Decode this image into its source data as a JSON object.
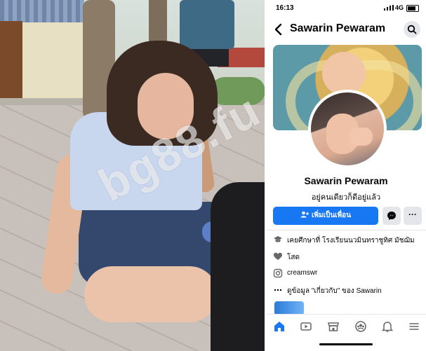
{
  "watermark": "bg88.fu",
  "status_bar": {
    "time": "16:13",
    "network": "4G"
  },
  "header": {
    "title": "Sawarin Pewaram"
  },
  "profile": {
    "name": "Sawarin Pewaram",
    "bio": "อยู่คนเดียวก็ดีอยู่แล้ว",
    "add_friend_label": "เพิ่มเป็นเพื่อน",
    "more_label": "···"
  },
  "details": {
    "education": "เคยศึกษาที่ โรงเรียนนวมินทราชูทิศ มัชฌิม",
    "relationship": "โสด",
    "instagram": "creamswr",
    "see_about": "ดูข้อมูล \"เกี่ยวกับ\" ของ Sawarin"
  },
  "colors": {
    "accent": "#1877f2",
    "button_bg": "#e4e6eb"
  },
  "icons": [
    "back-arrow-icon",
    "search-icon",
    "add-friend-icon",
    "messenger-icon",
    "more-icon",
    "education-icon",
    "heart-icon",
    "instagram-icon",
    "dots-icon",
    "home-icon",
    "video-icon",
    "marketplace-icon",
    "groups-icon",
    "bell-icon",
    "menu-icon"
  ]
}
